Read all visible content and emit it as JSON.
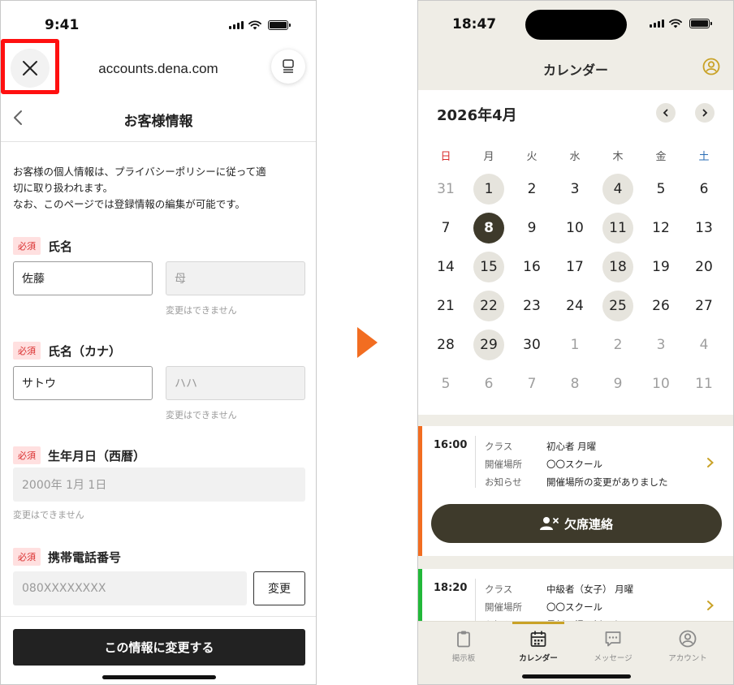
{
  "left": {
    "status_time": "9:41",
    "browser_url": "accounts.dena.com",
    "page_title": "お客様情報",
    "intro": [
      "お客様の個人情報は、プライバシーポリシーに従って適",
      "切に取り扱われます。",
      "なお、このページでは登録情報の編集が可能です。"
    ],
    "required_badge": "必須",
    "name": {
      "label": "氏名",
      "last_value": "佐藤",
      "first_value": "母",
      "note": "変更はできません"
    },
    "kana": {
      "label": "氏名（カナ）",
      "last_value": "サトウ",
      "first_value": "ハハ",
      "note": "変更はできません"
    },
    "birthday": {
      "label": "生年月日（西暦）",
      "value": "2000年 1月 1日",
      "note": "変更はできません"
    },
    "phone": {
      "label": "携帯電話番号",
      "value": "080XXXXXXXX",
      "change_label": "変更"
    },
    "submit_label": "この情報に変更する"
  },
  "right": {
    "status_time": "18:47",
    "title": "カレンダー",
    "month": "2026年4月",
    "weekdays": [
      "日",
      "月",
      "火",
      "水",
      "木",
      "金",
      "土"
    ],
    "weekday_colors": {
      "sunday": "#d92d2d",
      "saturday": "#2a6db5"
    },
    "weeks": [
      [
        "31",
        "1",
        "2",
        "3",
        "4",
        "5",
        "6"
      ],
      [
        "7",
        "8",
        "9",
        "10",
        "11",
        "12",
        "13"
      ],
      [
        "14",
        "15",
        "16",
        "17",
        "18",
        "19",
        "20"
      ],
      [
        "21",
        "22",
        "23",
        "24",
        "25",
        "26",
        "27"
      ],
      [
        "28",
        "29",
        "30",
        "1",
        "2",
        "3",
        "4"
      ],
      [
        "5",
        "6",
        "7",
        "8",
        "9",
        "10",
        "11"
      ]
    ],
    "selected_day": "8",
    "event_days": [
      "1",
      "4",
      "11",
      "15",
      "18",
      "22",
      "25",
      "29"
    ],
    "events": [
      {
        "time": "16:00",
        "stripe_color": "#f26d21",
        "rows": [
          {
            "k": "クラス",
            "v": "初心者 月曜"
          },
          {
            "k": "開催場所",
            "v": "〇〇スクール"
          },
          {
            "k": "お知らせ",
            "v": "開催場所の変更がありました"
          }
        ],
        "action_label": "欠席連絡"
      },
      {
        "time": "18:20",
        "stripe_color": "#22b83a",
        "rows": [
          {
            "k": "クラス",
            "v": "中級者（女子） 月曜"
          },
          {
            "k": "開催場所",
            "v": "〇〇スクール"
          },
          {
            "k": "お知らせ",
            "v": "最新の掲示板のタイトル"
          }
        ]
      }
    ],
    "tabs": [
      {
        "label": "掲示板",
        "icon": "clipboard-icon"
      },
      {
        "label": "カレンダー",
        "icon": "calendar-icon",
        "active": true
      },
      {
        "label": "メッセージ",
        "icon": "message-icon"
      },
      {
        "label": "アカウント",
        "icon": "account-icon"
      }
    ],
    "accent_color": "#c9a227",
    "dark_color": "#3e3a2b"
  }
}
